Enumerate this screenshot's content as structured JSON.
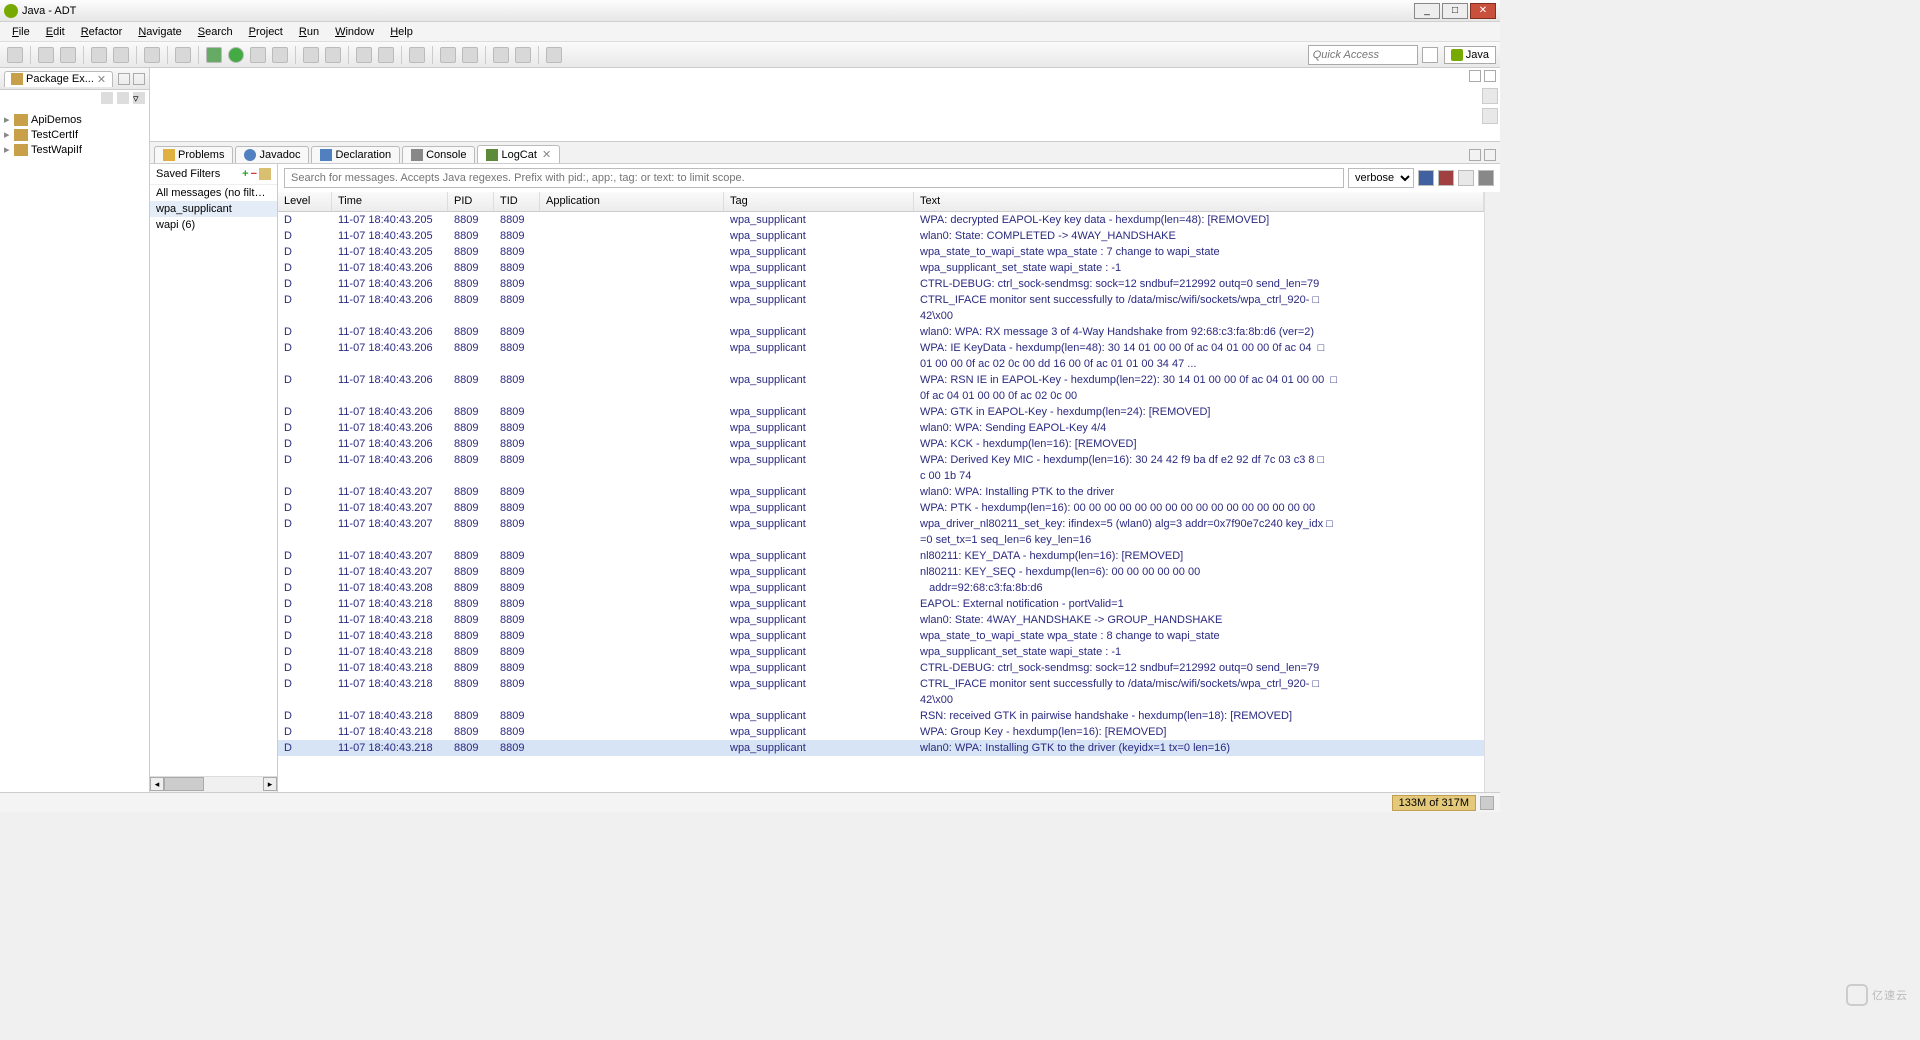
{
  "window": {
    "title": "Java - ADT"
  },
  "menus": [
    "File",
    "Edit",
    "Refactor",
    "Navigate",
    "Search",
    "Project",
    "Run",
    "Window",
    "Help"
  ],
  "quick_access_placeholder": "Quick Access",
  "perspective_label": "Java",
  "package_explorer": {
    "title": "Package Ex...",
    "projects": [
      "ApiDemos",
      "TestCertIf",
      "TestWapiIf"
    ]
  },
  "bottom_tabs": [
    "Problems",
    "Javadoc",
    "Declaration",
    "Console",
    "LogCat"
  ],
  "logcat": {
    "saved_filters_label": "Saved Filters",
    "filters": [
      "All messages (no filters) (",
      "wpa_supplicant",
      "wapi (6)"
    ],
    "selected_filter_index": 1,
    "search_placeholder": "Search for messages. Accepts Java regexes. Prefix with pid:, app:, tag: or text: to limit scope.",
    "level_select": "verbose",
    "columns": [
      "Level",
      "Time",
      "PID",
      "TID",
      "Application",
      "Tag",
      "Text"
    ],
    "rows": [
      {
        "l": "D",
        "t": "11-07 18:40:43.205",
        "p": "8809",
        "i": "8809",
        "a": "",
        "g": "wpa_supplicant",
        "x": "WPA: decrypted EAPOL-Key key data - hexdump(len=48): [REMOVED]"
      },
      {
        "l": "D",
        "t": "11-07 18:40:43.205",
        "p": "8809",
        "i": "8809",
        "a": "",
        "g": "wpa_supplicant",
        "x": "wlan0: State: COMPLETED -> 4WAY_HANDSHAKE"
      },
      {
        "l": "D",
        "t": "11-07 18:40:43.205",
        "p": "8809",
        "i": "8809",
        "a": "",
        "g": "wpa_supplicant",
        "x": "wpa_state_to_wapi_state wpa_state : 7 change to wapi_state"
      },
      {
        "l": "D",
        "t": "11-07 18:40:43.206",
        "p": "8809",
        "i": "8809",
        "a": "",
        "g": "wpa_supplicant",
        "x": "wpa_supplicant_set_state wapi_state : -1"
      },
      {
        "l": "D",
        "t": "11-07 18:40:43.206",
        "p": "8809",
        "i": "8809",
        "a": "",
        "g": "wpa_supplicant",
        "x": "CTRL-DEBUG: ctrl_sock-sendmsg: sock=12 sndbuf=212992 outq=0 send_len=79"
      },
      {
        "l": "D",
        "t": "11-07 18:40:43.206",
        "p": "8809",
        "i": "8809",
        "a": "",
        "g": "wpa_supplicant",
        "x": "CTRL_IFACE monitor sent successfully to /data/misc/wifi/sockets/wpa_ctrl_920- □\n42\\x00"
      },
      {
        "l": "D",
        "t": "11-07 18:40:43.206",
        "p": "8809",
        "i": "8809",
        "a": "",
        "g": "wpa_supplicant",
        "x": "wlan0: WPA: RX message 3 of 4-Way Handshake from 92:68:c3:fa:8b:d6 (ver=2)"
      },
      {
        "l": "D",
        "t": "11-07 18:40:43.206",
        "p": "8809",
        "i": "8809",
        "a": "",
        "g": "wpa_supplicant",
        "x": "WPA: IE KeyData - hexdump(len=48): 30 14 01 00 00 0f ac 04 01 00 00 0f ac 04  □\n01 00 00 0f ac 02 0c 00 dd 16 00 0f ac 01 01 00 34 47 ..."
      },
      {
        "l": "D",
        "t": "11-07 18:40:43.206",
        "p": "8809",
        "i": "8809",
        "a": "",
        "g": "wpa_supplicant",
        "x": "WPA: RSN IE in EAPOL-Key - hexdump(len=22): 30 14 01 00 00 0f ac 04 01 00 00  □\n0f ac 04 01 00 00 0f ac 02 0c 00"
      },
      {
        "l": "D",
        "t": "11-07 18:40:43.206",
        "p": "8809",
        "i": "8809",
        "a": "",
        "g": "wpa_supplicant",
        "x": "WPA: GTK in EAPOL-Key - hexdump(len=24): [REMOVED]"
      },
      {
        "l": "D",
        "t": "11-07 18:40:43.206",
        "p": "8809",
        "i": "8809",
        "a": "",
        "g": "wpa_supplicant",
        "x": "wlan0: WPA: Sending EAPOL-Key 4/4"
      },
      {
        "l": "D",
        "t": "11-07 18:40:43.206",
        "p": "8809",
        "i": "8809",
        "a": "",
        "g": "wpa_supplicant",
        "x": "WPA: KCK - hexdump(len=16): [REMOVED]"
      },
      {
        "l": "D",
        "t": "11-07 18:40:43.206",
        "p": "8809",
        "i": "8809",
        "a": "",
        "g": "wpa_supplicant",
        "x": "WPA: Derived Key MIC - hexdump(len=16): 30 24 42 f9 ba df e2 92 df 7c 03 c3 8 □\nc 00 1b 74"
      },
      {
        "l": "D",
        "t": "11-07 18:40:43.207",
        "p": "8809",
        "i": "8809",
        "a": "",
        "g": "wpa_supplicant",
        "x": "wlan0: WPA: Installing PTK to the driver"
      },
      {
        "l": "D",
        "t": "11-07 18:40:43.207",
        "p": "8809",
        "i": "8809",
        "a": "",
        "g": "wpa_supplicant",
        "x": "WPA: PTK - hexdump(len=16): 00 00 00 00 00 00 00 00 00 00 00 00 00 00 00 00"
      },
      {
        "l": "D",
        "t": "11-07 18:40:43.207",
        "p": "8809",
        "i": "8809",
        "a": "",
        "g": "wpa_supplicant",
        "x": "wpa_driver_nl80211_set_key: ifindex=5 (wlan0) alg=3 addr=0x7f90e7c240 key_idx □\n=0 set_tx=1 seq_len=6 key_len=16"
      },
      {
        "l": "D",
        "t": "11-07 18:40:43.207",
        "p": "8809",
        "i": "8809",
        "a": "",
        "g": "wpa_supplicant",
        "x": "nl80211: KEY_DATA - hexdump(len=16): [REMOVED]"
      },
      {
        "l": "D",
        "t": "11-07 18:40:43.207",
        "p": "8809",
        "i": "8809",
        "a": "",
        "g": "wpa_supplicant",
        "x": "nl80211: KEY_SEQ - hexdump(len=6): 00 00 00 00 00 00"
      },
      {
        "l": "D",
        "t": "11-07 18:40:43.208",
        "p": "8809",
        "i": "8809",
        "a": "",
        "g": "wpa_supplicant",
        "x": "   addr=92:68:c3:fa:8b:d6"
      },
      {
        "l": "D",
        "t": "11-07 18:40:43.218",
        "p": "8809",
        "i": "8809",
        "a": "",
        "g": "wpa_supplicant",
        "x": "EAPOL: External notification - portValid=1"
      },
      {
        "l": "D",
        "t": "11-07 18:40:43.218",
        "p": "8809",
        "i": "8809",
        "a": "",
        "g": "wpa_supplicant",
        "x": "wlan0: State: 4WAY_HANDSHAKE -> GROUP_HANDSHAKE"
      },
      {
        "l": "D",
        "t": "11-07 18:40:43.218",
        "p": "8809",
        "i": "8809",
        "a": "",
        "g": "wpa_supplicant",
        "x": "wpa_state_to_wapi_state wpa_state : 8 change to wapi_state"
      },
      {
        "l": "D",
        "t": "11-07 18:40:43.218",
        "p": "8809",
        "i": "8809",
        "a": "",
        "g": "wpa_supplicant",
        "x": "wpa_supplicant_set_state wapi_state : -1"
      },
      {
        "l": "D",
        "t": "11-07 18:40:43.218",
        "p": "8809",
        "i": "8809",
        "a": "",
        "g": "wpa_supplicant",
        "x": "CTRL-DEBUG: ctrl_sock-sendmsg: sock=12 sndbuf=212992 outq=0 send_len=79"
      },
      {
        "l": "D",
        "t": "11-07 18:40:43.218",
        "p": "8809",
        "i": "8809",
        "a": "",
        "g": "wpa_supplicant",
        "x": "CTRL_IFACE monitor sent successfully to /data/misc/wifi/sockets/wpa_ctrl_920- □\n42\\x00"
      },
      {
        "l": "D",
        "t": "11-07 18:40:43.218",
        "p": "8809",
        "i": "8809",
        "a": "",
        "g": "wpa_supplicant",
        "x": "RSN: received GTK in pairwise handshake - hexdump(len=18): [REMOVED]"
      },
      {
        "l": "D",
        "t": "11-07 18:40:43.218",
        "p": "8809",
        "i": "8809",
        "a": "",
        "g": "wpa_supplicant",
        "x": "WPA: Group Key - hexdump(len=16): [REMOVED]"
      },
      {
        "l": "D",
        "t": "11-07 18:40:43.218",
        "p": "8809",
        "i": "8809",
        "a": "",
        "g": "wpa_supplicant",
        "x": "wlan0: WPA: Installing GTK to the driver (keyidx=1 tx=0 len=16)",
        "sel": true
      }
    ]
  },
  "status": {
    "memory": "133M of 317M"
  },
  "watermark": "亿速云"
}
